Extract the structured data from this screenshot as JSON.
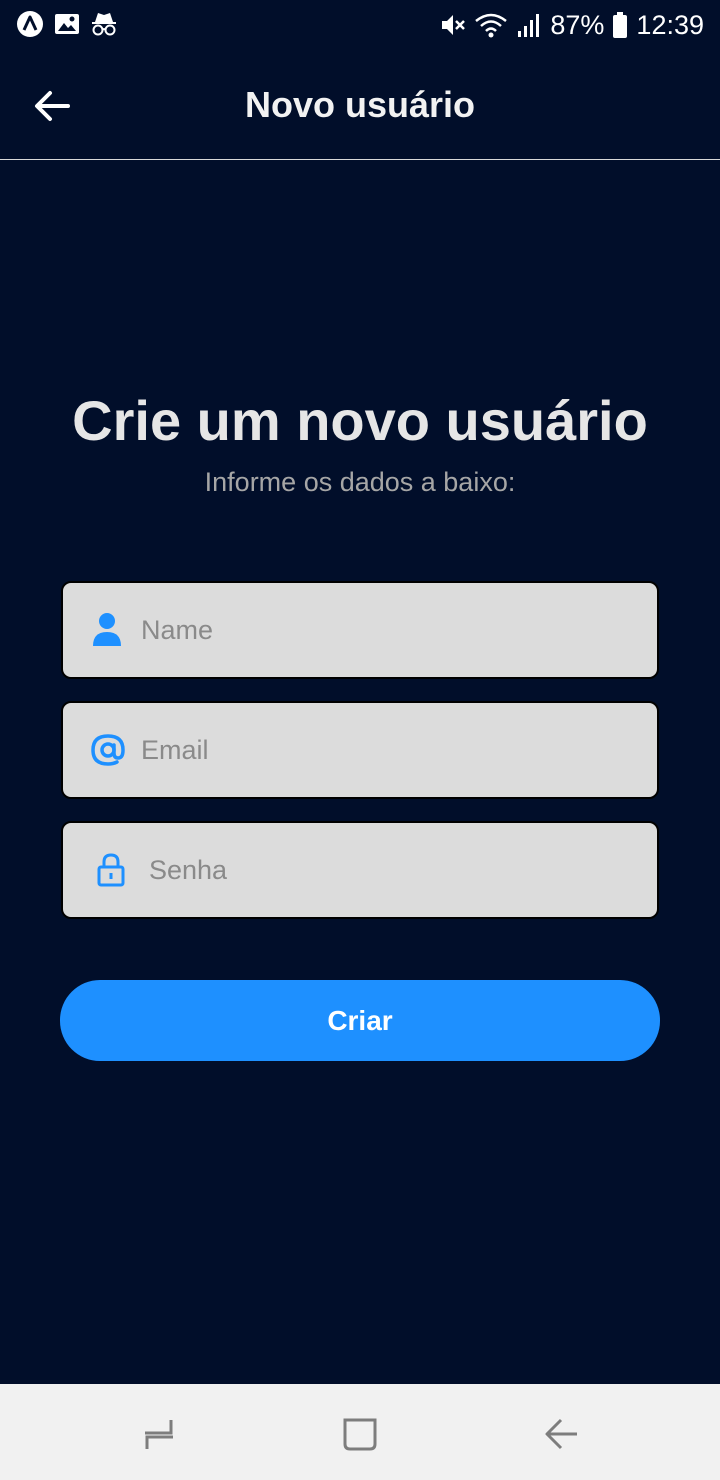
{
  "status_bar": {
    "left_icons": [
      "app-a-icon",
      "image-icon",
      "incognito-icon"
    ],
    "right_icons": [
      "mute-icon",
      "wifi-icon",
      "signal-icon",
      "battery-icon"
    ],
    "battery_percent": "87%",
    "time": "12:39"
  },
  "app_bar": {
    "back_icon": "arrow-left-icon",
    "title": "Novo usuário"
  },
  "form": {
    "heading": "Crie um novo usuário",
    "subheading": "Informe os dados a baixo:",
    "name_field": {
      "icon": "user-icon",
      "placeholder": "Name",
      "value": ""
    },
    "email_field": {
      "icon": "at-icon",
      "placeholder": "Email",
      "value": ""
    },
    "password_field": {
      "icon": "lock-icon",
      "placeholder": "Senha",
      "value": ""
    },
    "submit_label": "Criar"
  },
  "nav_bar": {
    "buttons": [
      "recent-apps-icon",
      "home-icon",
      "back-icon"
    ]
  },
  "colors": {
    "background": "#010e2a",
    "accent": "#1e90ff",
    "field_background": "#dcdcdc",
    "nav_background": "#f1f1f1"
  }
}
